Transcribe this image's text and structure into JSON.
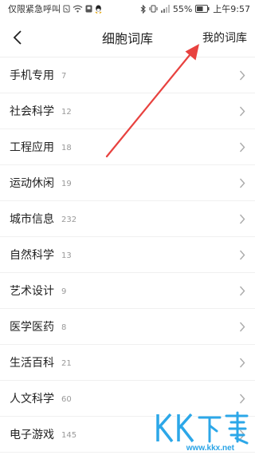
{
  "status": {
    "carrier": "仅限紧急呼叫",
    "battery": "55%",
    "time": "上午9:57"
  },
  "header": {
    "title": "细胞词库",
    "action": "我的词库"
  },
  "categories": [
    {
      "label": "手机专用",
      "count": "7"
    },
    {
      "label": "社会科学",
      "count": "12"
    },
    {
      "label": "工程应用",
      "count": "18"
    },
    {
      "label": "运动休闲",
      "count": "19"
    },
    {
      "label": "城市信息",
      "count": "232"
    },
    {
      "label": "自然科学",
      "count": "13"
    },
    {
      "label": "艺术设计",
      "count": "9"
    },
    {
      "label": "医学医药",
      "count": "8"
    },
    {
      "label": "生活百科",
      "count": "21"
    },
    {
      "label": "人文科学",
      "count": "60"
    },
    {
      "label": "电子游戏",
      "count": "145"
    }
  ],
  "annotation": {
    "color": "#e8423f"
  },
  "watermark": {
    "text": "www.kkx.net"
  },
  "icons": {
    "back": "chevron-left-icon",
    "row": "chevron-right-icon"
  }
}
